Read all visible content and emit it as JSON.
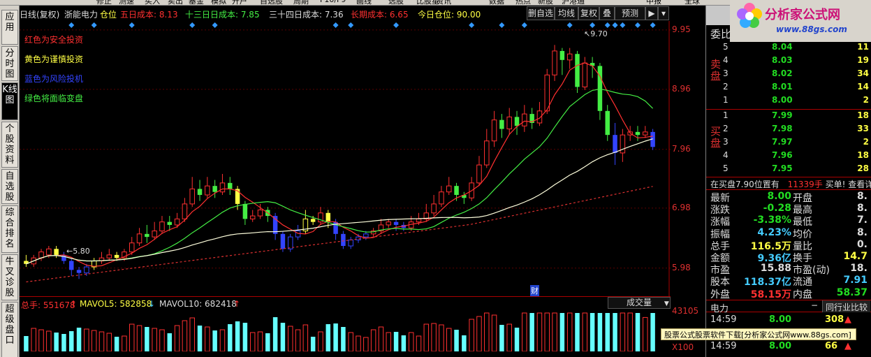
{
  "menu": [
    "修正",
    "测速",
    "买入",
    "卖出",
    "基金",
    "模拟",
    "开户",
    "自选股",
    "周期",
    "F10/F9",
    "画线",
    "选股",
    "比股星",
    "资讯",
    "数据",
    "热点",
    "新股",
    "沪港通",
    "中报",
    "全球"
  ],
  "left_tabs": [
    "应用",
    "分时图",
    "K线图",
    "个股资料",
    "自选股",
    "综合排名",
    "牛叉诊股",
    "超级盘口"
  ],
  "header": {
    "period": "日线(复权)",
    "stock": "浙能电力",
    "cost_label": "仓位",
    "cost5": "五日成本: 8.13",
    "cost13": "十三日日成本: 7.85",
    "cost34": "三十四日成本: 7.36",
    "cost_long": "长期成本: 6.65",
    "today_pos": "今日仓位: 90.00"
  },
  "chart_buttons": [
    "删自选",
    "均线",
    "复权",
    "叠",
    "预测",
    "▶",
    "▾"
  ],
  "price_axis": [
    "9.95",
    "8.96",
    "7.96",
    "6.98",
    "5.98"
  ],
  "annotations": {
    "high": "9.70",
    "low": "5.80",
    "marker": "财"
  },
  "legend": [
    {
      "text": "红色为安全投资",
      "color": "#ff3030"
    },
    {
      "text": "黄色为谨慎投资",
      "color": "#ffff44"
    },
    {
      "text": "蓝色为风险投机",
      "color": "#3344ff"
    },
    {
      "text": "绿色将面临变盘",
      "color": "#44ee44"
    }
  ],
  "volume": {
    "total": "总手: 551678",
    "mavol5": "MAVOL5: 582858",
    "mavol10": "MAVOL10: 682418",
    "indicator": "成交量",
    "axis_top": "43105",
    "axis_unit": "X100"
  },
  "right_panel": {
    "title": "委比",
    "sell_label": "卖盘",
    "buy_label": "买盘",
    "asks": [
      {
        "lvl": "5",
        "price": "8.04",
        "vol": "11"
      },
      {
        "lvl": "4",
        "price": "8.03",
        "vol": "19"
      },
      {
        "lvl": "3",
        "price": "8.02",
        "vol": "34"
      },
      {
        "lvl": "2",
        "price": "8.01",
        "vol": "14"
      },
      {
        "lvl": "1",
        "price": "8.00",
        "vol": "2"
      }
    ],
    "bids": [
      {
        "lvl": "1",
        "price": "7.99",
        "vol": "18"
      },
      {
        "lvl": "2",
        "price": "7.98",
        "vol": "33"
      },
      {
        "lvl": "3",
        "price": "7.97",
        "vol": "2"
      },
      {
        "lvl": "4",
        "price": "7.96",
        "vol": "18"
      },
      {
        "lvl": "5",
        "price": "7.95",
        "vol": "28"
      }
    ],
    "notice": "在买盘7.90位置有",
    "notice_vol": "11339手",
    "notice_tail": "买单! 查看详",
    "stats": [
      {
        "l1": "最新",
        "v1": "8.00",
        "c1": "#22dd22",
        "l2": "开盘",
        "v2": "8.",
        "c2": "#ddd"
      },
      {
        "l1": "涨跌",
        "v1": "-0.28",
        "c1": "#22dd22",
        "l2": "最高",
        "v2": "8.",
        "c2": "#ddd"
      },
      {
        "l1": "涨幅",
        "v1": "-3.38%",
        "c1": "#22dd22",
        "l2": "最低",
        "v2": "7.",
        "c2": "#ddd"
      },
      {
        "l1": "振幅",
        "v1": "4.23%",
        "c1": "#44ccff",
        "l2": "均价",
        "v2": "8.",
        "c2": "#ddd"
      },
      {
        "l1": "总手",
        "v1": "116.5万",
        "c1": "#ffff44",
        "l2": "量比",
        "v2": "0.",
        "c2": "#ddd"
      },
      {
        "l1": "金额",
        "v1": "9.36亿",
        "c1": "#44ccff",
        "l2": "换手",
        "v2": "14.7",
        "c2": "#ffff44"
      },
      {
        "l1": "市盈",
        "v1": "15.88",
        "c1": "#ddd",
        "l2": "市盈(动)",
        "v2": "18.",
        "c2": "#ddd"
      },
      {
        "l1": "股本",
        "v1": "118.37亿",
        "c1": "#44ccff",
        "l2": "流通",
        "v2": "7.91",
        "c2": "#44ccff"
      },
      {
        "l1": "外盘",
        "v1": "58.15万",
        "c1": "#ff3030",
        "l2": "内盘",
        "v2": "58.37",
        "c2": "#22dd22"
      }
    ],
    "tab_left": "电力",
    "tab_right": "同行业比较",
    "ticks": [
      {
        "t": "14:59",
        "p": "8.00",
        "v": "308"
      },
      {
        "t": "14:59",
        "p": "8.00",
        "v": "66"
      }
    ]
  },
  "logo": {
    "title": "分析家公式网",
    "url": "www.88gs.com"
  },
  "watermark": "股票公式股票软件下载[分析家公式网www.88gs.com]",
  "chart_data": {
    "type": "candlestick",
    "ylim": [
      5.5,
      10.1
    ],
    "y_ticks": [
      9.95,
      8.96,
      7.96,
      6.98,
      5.98
    ],
    "candles": [
      [
        6.1,
        6.05,
        6.2,
        6.0
      ],
      [
        6.05,
        6.15,
        6.2,
        6.0
      ],
      [
        6.15,
        6.25,
        6.3,
        6.1
      ],
      [
        6.2,
        6.3,
        6.35,
        6.15
      ],
      [
        6.3,
        6.2,
        6.35,
        6.15
      ],
      [
        6.2,
        6.1,
        6.25,
        6.05
      ],
      [
        6.1,
        5.95,
        6.15,
        5.85
      ],
      [
        5.95,
        5.9,
        6.0,
        5.8
      ],
      [
        5.9,
        6.0,
        6.05,
        5.85
      ],
      [
        6.0,
        6.1,
        6.15,
        5.95
      ],
      [
        6.1,
        6.15,
        6.25,
        6.05
      ],
      [
        6.15,
        6.2,
        6.3,
        6.1
      ],
      [
        6.2,
        6.15,
        6.25,
        6.1
      ],
      [
        6.15,
        6.25,
        6.3,
        6.1
      ],
      [
        6.25,
        6.4,
        6.5,
        6.2
      ],
      [
        6.4,
        6.55,
        6.65,
        6.35
      ],
      [
        6.55,
        6.5,
        6.7,
        6.4
      ],
      [
        6.5,
        6.6,
        6.75,
        6.45
      ],
      [
        6.6,
        6.75,
        6.85,
        6.55
      ],
      [
        6.75,
        6.7,
        6.85,
        6.6
      ],
      [
        6.7,
        6.8,
        6.9,
        6.65
      ],
      [
        6.8,
        7.05,
        7.15,
        6.75
      ],
      [
        7.05,
        7.3,
        7.5,
        7.0
      ],
      [
        7.3,
        7.2,
        7.45,
        7.1
      ],
      [
        7.2,
        7.35,
        7.5,
        7.15
      ],
      [
        7.35,
        7.25,
        7.45,
        7.15
      ],
      [
        7.25,
        7.4,
        7.55,
        7.2
      ],
      [
        7.4,
        7.3,
        7.5,
        7.2
      ],
      [
        7.3,
        7.05,
        7.35,
        6.95
      ],
      [
        7.05,
        6.8,
        7.1,
        6.7
      ],
      [
        6.8,
        6.85,
        6.95,
        6.75
      ],
      [
        6.85,
        6.95,
        7.05,
        6.8
      ],
      [
        6.95,
        6.85,
        7.0,
        6.75
      ],
      [
        6.85,
        6.55,
        6.9,
        6.45
      ],
      [
        6.55,
        6.3,
        6.6,
        6.25
      ],
      [
        6.3,
        6.5,
        6.55,
        6.25
      ],
      [
        6.5,
        6.6,
        6.7,
        6.45
      ],
      [
        6.6,
        6.8,
        6.95,
        6.55
      ],
      [
        6.8,
        6.75,
        6.85,
        6.7
      ],
      [
        6.75,
        6.9,
        7.0,
        6.7
      ],
      [
        6.9,
        6.75,
        6.95,
        6.65
      ],
      [
        6.75,
        6.55,
        6.8,
        6.45
      ],
      [
        6.55,
        6.35,
        6.6,
        6.3
      ],
      [
        6.35,
        6.45,
        6.5,
        6.3
      ],
      [
        6.45,
        6.5,
        6.55,
        6.4
      ],
      [
        6.5,
        6.55,
        6.6,
        6.45
      ],
      [
        6.55,
        6.6,
        6.65,
        6.5
      ],
      [
        6.6,
        6.7,
        6.8,
        6.55
      ],
      [
        6.7,
        6.75,
        6.8,
        6.65
      ],
      [
        6.75,
        6.7,
        6.8,
        6.6
      ],
      [
        6.7,
        6.65,
        6.75,
        6.6
      ],
      [
        6.65,
        6.75,
        6.85,
        6.6
      ],
      [
        6.75,
        6.8,
        6.9,
        6.7
      ],
      [
        6.8,
        6.9,
        7.05,
        6.75
      ],
      [
        6.9,
        7.05,
        7.2,
        6.85
      ],
      [
        7.05,
        7.25,
        7.35,
        7.0
      ],
      [
        7.25,
        7.35,
        7.5,
        7.2
      ],
      [
        7.35,
        7.2,
        7.4,
        7.1
      ],
      [
        7.2,
        7.15,
        7.25,
        7.05
      ],
      [
        7.15,
        7.4,
        7.5,
        7.1
      ],
      [
        7.4,
        7.7,
        7.85,
        7.35
      ],
      [
        7.7,
        8.1,
        8.3,
        7.65
      ],
      [
        8.1,
        8.45,
        8.6,
        8.0
      ],
      [
        8.45,
        8.3,
        8.55,
        8.15
      ],
      [
        8.3,
        8.5,
        8.65,
        8.2
      ],
      [
        8.5,
        8.35,
        8.6,
        8.2
      ],
      [
        8.35,
        8.55,
        8.7,
        8.25
      ],
      [
        8.55,
        8.4,
        8.65,
        8.3
      ],
      [
        8.4,
        8.6,
        8.75,
        8.35
      ],
      [
        8.6,
        9.2,
        9.3,
        8.55
      ],
      [
        9.2,
        9.6,
        9.7,
        9.1
      ],
      [
        9.6,
        9.45,
        9.65,
        9.2
      ],
      [
        9.45,
        9.55,
        9.65,
        9.3
      ],
      [
        9.55,
        9.0,
        9.6,
        8.9
      ],
      [
        9.0,
        9.4,
        9.5,
        8.95
      ],
      [
        9.4,
        9.35,
        9.5,
        9.15
      ],
      [
        9.35,
        8.6,
        9.4,
        8.45
      ],
      [
        8.6,
        8.2,
        8.7,
        8.1
      ],
      [
        8.2,
        7.9,
        8.4,
        7.7
      ],
      [
        7.9,
        8.2,
        8.3,
        7.75
      ],
      [
        8.2,
        8.25,
        8.35,
        8.1
      ],
      [
        8.25,
        8.2,
        8.35,
        8.1
      ],
      [
        8.2,
        8.25,
        8.35,
        8.15
      ],
      [
        8.25,
        8.0,
        8.3,
        7.95
      ]
    ]
  }
}
